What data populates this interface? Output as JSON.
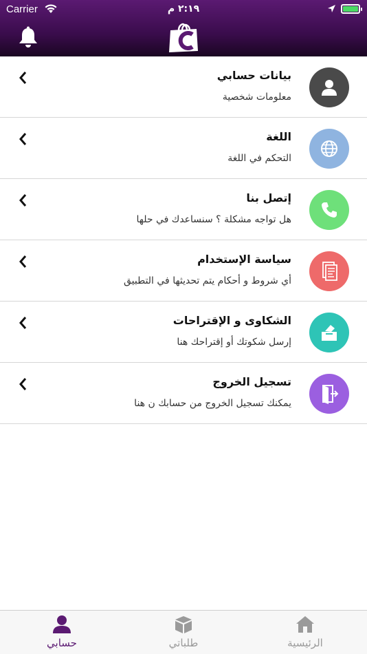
{
  "status_bar": {
    "carrier": "Carrier",
    "time": "٢:١٩ م"
  },
  "header": {
    "bell_icon": "bell-icon",
    "logo_icon": "shopping-bag-logo-icon"
  },
  "menu": [
    {
      "title": "بيانات حسابي",
      "subtitle": "معلومات شخصية",
      "icon": "user-icon",
      "color": "#4a4a4a"
    },
    {
      "title": "اللغة",
      "subtitle": "التحكم في  اللغة",
      "icon": "globe-icon",
      "color": "#8fb4e0"
    },
    {
      "title": "إتصل بنا",
      "subtitle": "هل تواجه مشكلة ؟ سنساعدك في حلها",
      "icon": "phone-icon",
      "color": "#6ee07a"
    },
    {
      "title": "سياسة الإستخدام",
      "subtitle": "أي شروط و أحكام يتم تحديثها في التطبيق",
      "icon": "document-icon",
      "color": "#ee6a6a"
    },
    {
      "title": "الشكاوى و الإقتراحات",
      "subtitle": "إرسل شكوتك أو إقتراحك هنا",
      "icon": "ballot-box-icon",
      "color": "#2ec4b6"
    },
    {
      "title": "تسجيل الخروج",
      "subtitle": "يمكنك تسجيل الخروج من حسابك ن هنا",
      "icon": "logout-door-icon",
      "color": "#9b5fe0"
    }
  ],
  "tabbar": {
    "account": "حسابي",
    "orders": "طلباتي",
    "home": "الرئيسية",
    "active_color": "#5b1a72",
    "inactive_color": "#9a9a9a"
  }
}
